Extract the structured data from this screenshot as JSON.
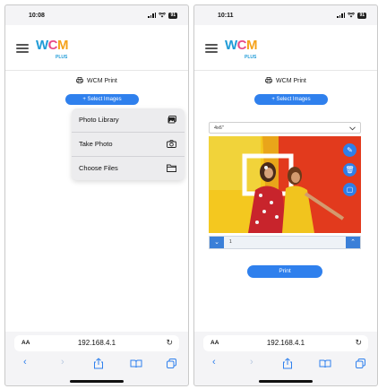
{
  "left": {
    "status": {
      "time": "10:08",
      "battery": "91"
    },
    "logo": {
      "w": "W",
      "c": "C",
      "m": "M",
      "plus": "PLUS"
    },
    "print_title": "WCM Print",
    "select_button": "+ Select Images",
    "menu": [
      {
        "label": "Photo Library",
        "icon": "photo-library-icon"
      },
      {
        "label": "Take Photo",
        "icon": "camera-icon"
      },
      {
        "label": "Choose Files",
        "icon": "folder-icon"
      }
    ],
    "url": {
      "aa": "AA",
      "address": "192.168.4.1"
    },
    "toolbar": {
      "back": "‹",
      "forward": "›"
    }
  },
  "right": {
    "status": {
      "time": "10:11",
      "battery": "91"
    },
    "logo": {
      "w": "W",
      "c": "C",
      "m": "M",
      "plus": "PLUS"
    },
    "print_title": "WCM Print",
    "select_button": "+ Select Images",
    "size_select": {
      "value": "4x6\""
    },
    "photo_actions": [
      "edit-icon",
      "delete-icon",
      "crop-icon"
    ],
    "bottom_bar": {
      "caption": "1"
    },
    "print_button": "Print",
    "url": {
      "aa": "AA",
      "address": "192.168.4.1"
    },
    "toolbar": {
      "back": "‹",
      "forward": "›"
    }
  },
  "colors": {
    "accent": "#2f80ed",
    "logo_w": "#1f9bd7",
    "logo_c": "#e94b87",
    "logo_m": "#f5a21a"
  }
}
